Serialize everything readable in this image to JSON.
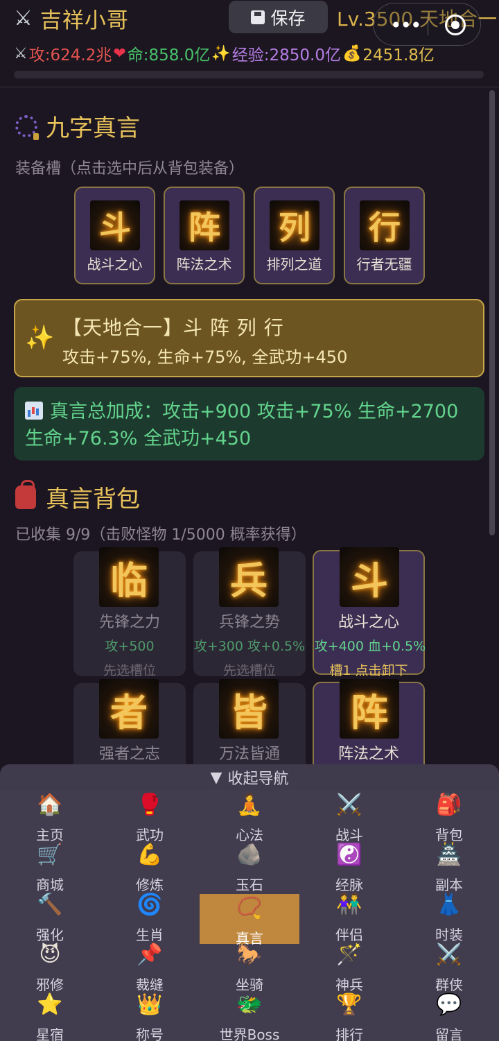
{
  "header": {
    "player_name": "吉祥小哥",
    "save_label": "保存",
    "level_text": "Lv.3500 天地合一",
    "stats": {
      "attack": "攻:624.2兆",
      "hp": "命:858.0亿",
      "exp": "经验:2850.0亿",
      "gold": "2451.8亿"
    }
  },
  "equip_section": {
    "title": "九字真言",
    "hint": "装备槽（点击选中后从背包装备）",
    "slots": [
      {
        "glyph": "斗",
        "label": "战斗之心"
      },
      {
        "glyph": "阵",
        "label": "阵法之术"
      },
      {
        "glyph": "列",
        "label": "排列之道"
      },
      {
        "glyph": "行",
        "label": "行者无疆"
      }
    ]
  },
  "set_bonus": {
    "title": "【天地合一】斗 阵 列 行",
    "desc": "攻击+75%, 生命+75%, 全武功+450"
  },
  "total_bonus": {
    "text": "真言总加成：攻击+900 攻击+75% 生命+2700 生命+76.3% 全武功+450"
  },
  "bag_section": {
    "title": "真言背包",
    "collected": "已收集 9/9（击败怪物 1/5000 概率获得）",
    "cards": [
      {
        "glyph": "临",
        "name": "先锋之力",
        "effect": "攻+500",
        "state": "先选槽位"
      },
      {
        "glyph": "兵",
        "name": "兵锋之势",
        "effect": "攻+300 攻+0.5%",
        "state": "先选槽位"
      },
      {
        "glyph": "斗",
        "name": "战斗之心",
        "effect": "攻+400 血+0.5%",
        "state": "槽1 点击卸下"
      },
      {
        "glyph": "者",
        "name": "强者之志",
        "effect": "",
        "state": ""
      },
      {
        "glyph": "皆",
        "name": "万法皆通",
        "effect": "",
        "state": ""
      },
      {
        "glyph": "阵",
        "name": "阵法之术",
        "effect": "",
        "state": ""
      }
    ]
  },
  "nav": {
    "collapse_label": "收起导航",
    "items": [
      {
        "label": "主页",
        "icon": "🏠"
      },
      {
        "label": "武功",
        "icon": "🥊"
      },
      {
        "label": "心法",
        "icon": "🧘"
      },
      {
        "label": "战斗",
        "icon": "⚔️"
      },
      {
        "label": "背包",
        "icon": "🎒"
      },
      {
        "label": "商城",
        "icon": "🛒"
      },
      {
        "label": "修炼",
        "icon": "💪"
      },
      {
        "label": "玉石",
        "icon": "🪨"
      },
      {
        "label": "经脉",
        "icon": "☯️"
      },
      {
        "label": "副本",
        "icon": "🏯"
      },
      {
        "label": "强化",
        "icon": "🔨"
      },
      {
        "label": "生肖",
        "icon": "🌀"
      },
      {
        "label": "真言",
        "icon": "📿"
      },
      {
        "label": "伴侣",
        "icon": "👫"
      },
      {
        "label": "时装",
        "icon": "👗"
      },
      {
        "label": "邪修",
        "icon": "😈"
      },
      {
        "label": "裁缝",
        "icon": "📌"
      },
      {
        "label": "坐骑",
        "icon": "🐎"
      },
      {
        "label": "神兵",
        "icon": "🪄"
      },
      {
        "label": "群侠",
        "icon": "⚔️"
      },
      {
        "label": "星宿",
        "icon": "⭐"
      },
      {
        "label": "称号",
        "icon": "👑"
      },
      {
        "label": "世界Boss",
        "icon": "🐲"
      },
      {
        "label": "排行",
        "icon": "🏆"
      },
      {
        "label": "留言",
        "icon": "💬"
      }
    ],
    "active": "真言"
  }
}
